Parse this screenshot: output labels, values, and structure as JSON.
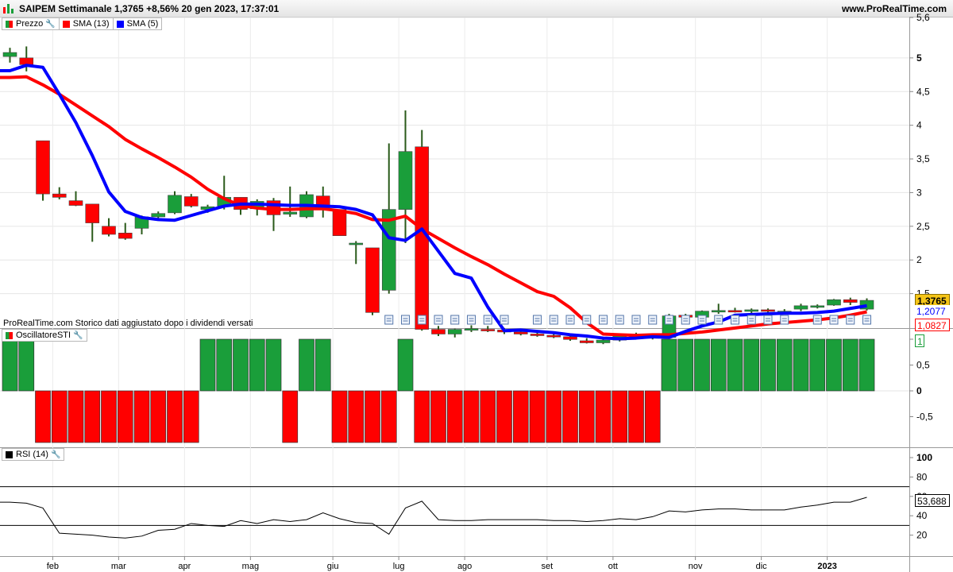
{
  "header": {
    "title": "SAIPEM Settimanale 1,3765 +8,56% 20 gen 2023, 17:37:01",
    "site": "www.ProRealTime.com"
  },
  "legend_price": [
    {
      "label": "Prezzo",
      "color": "#1a9e3a"
    },
    {
      "label": "SMA (13)",
      "color": "#ff0000"
    },
    {
      "label": "SMA (5)",
      "color": "#0000ff"
    }
  ],
  "legend_osc": {
    "label": "OscillatoreSTI",
    "color": "#1a9e3a"
  },
  "legend_rsi": {
    "label": "RSI (14)",
    "color": "#000000"
  },
  "note": "ProRealTime.com Storico dati aggiustato dopo i dividendi versati",
  "tags": {
    "price": "1,3765",
    "sma5": "1,2077",
    "sma13": "1,0827",
    "osc": "1",
    "rsi": "53,688"
  },
  "colors": {
    "up": "#1a9e3a",
    "down": "#ff0000",
    "sma13": "#ff0000",
    "sma5": "#0000ff",
    "wick": "#2a5a1a"
  },
  "chart_data": [
    {
      "type": "candlestick",
      "ylim": [
        1.0,
        5.6
      ],
      "y_ticks": [
        "5,6",
        "5",
        "4,5",
        "4",
        "3,5",
        "3",
        "2,5",
        "2",
        "1,5"
      ],
      "x_tick_labels": [
        "feb",
        "mar",
        "apr",
        "mag",
        "giu",
        "lug",
        "ago",
        "set",
        "ott",
        "nov",
        "dic",
        "2023"
      ],
      "x_tick_bar_index": [
        3,
        7,
        11,
        15,
        20,
        24,
        28,
        33,
        37,
        42,
        46,
        50
      ],
      "candles": [
        {
          "o": 5.02,
          "h": 5.15,
          "l": 4.93,
          "c": 5.08
        },
        {
          "o": 5.0,
          "h": 5.17,
          "l": 4.8,
          "c": 4.9
        },
        {
          "o": 3.77,
          "h": 3.77,
          "l": 2.88,
          "c": 2.98
        },
        {
          "o": 2.98,
          "h": 3.08,
          "l": 2.9,
          "c": 2.93
        },
        {
          "o": 2.88,
          "h": 3.02,
          "l": 2.8,
          "c": 2.81
        },
        {
          "o": 2.83,
          "h": 2.83,
          "l": 2.27,
          "c": 2.55
        },
        {
          "o": 2.5,
          "h": 2.62,
          "l": 2.35,
          "c": 2.38
        },
        {
          "o": 2.4,
          "h": 2.55,
          "l": 2.3,
          "c": 2.32
        },
        {
          "o": 2.47,
          "h": 2.66,
          "l": 2.38,
          "c": 2.64
        },
        {
          "o": 2.64,
          "h": 2.72,
          "l": 2.6,
          "c": 2.69
        },
        {
          "o": 2.7,
          "h": 3.02,
          "l": 2.68,
          "c": 2.96
        },
        {
          "o": 2.94,
          "h": 2.98,
          "l": 2.78,
          "c": 2.8
        },
        {
          "o": 2.75,
          "h": 2.82,
          "l": 2.7,
          "c": 2.79
        },
        {
          "o": 2.8,
          "h": 3.25,
          "l": 2.75,
          "c": 2.93
        },
        {
          "o": 2.93,
          "h": 2.93,
          "l": 2.67,
          "c": 2.75
        },
        {
          "o": 2.76,
          "h": 2.9,
          "l": 2.66,
          "c": 2.87
        },
        {
          "o": 2.88,
          "h": 2.92,
          "l": 2.43,
          "c": 2.67
        },
        {
          "o": 2.68,
          "h": 3.09,
          "l": 2.64,
          "c": 2.71
        },
        {
          "o": 2.64,
          "h": 3.02,
          "l": 2.62,
          "c": 2.97
        },
        {
          "o": 2.95,
          "h": 3.09,
          "l": 2.63,
          "c": 2.76
        },
        {
          "o": 2.75,
          "h": 2.75,
          "l": 2.36,
          "c": 2.36
        },
        {
          "o": 2.25,
          "h": 2.28,
          "l": 1.94,
          "c": 2.25
        },
        {
          "o": 2.18,
          "h": 2.18,
          "l": 1.18,
          "c": 1.22
        },
        {
          "o": 1.55,
          "h": 3.73,
          "l": 1.5,
          "c": 2.75
        },
        {
          "o": 2.75,
          "h": 4.22,
          "l": 2.25,
          "c": 3.61
        },
        {
          "o": 3.68,
          "h": 3.93,
          "l": 0.95,
          "c": 0.97
        },
        {
          "o": 0.97,
          "h": 1.02,
          "l": 0.87,
          "c": 0.9
        },
        {
          "o": 0.9,
          "h": 0.98,
          "l": 0.85,
          "c": 0.97
        },
        {
          "o": 0.96,
          "h": 1.03,
          "l": 0.93,
          "c": 0.98
        },
        {
          "o": 0.97,
          "h": 1.02,
          "l": 0.93,
          "c": 0.96
        },
        {
          "o": 0.96,
          "h": 0.99,
          "l": 0.9,
          "c": 0.93
        },
        {
          "o": 0.93,
          "h": 0.96,
          "l": 0.88,
          "c": 0.9
        },
        {
          "o": 0.9,
          "h": 0.95,
          "l": 0.86,
          "c": 0.88
        },
        {
          "o": 0.88,
          "h": 0.93,
          "l": 0.84,
          "c": 0.86
        },
        {
          "o": 0.86,
          "h": 0.9,
          "l": 0.8,
          "c": 0.82
        },
        {
          "o": 0.8,
          "h": 0.84,
          "l": 0.76,
          "c": 0.77
        },
        {
          "o": 0.77,
          "h": 0.83,
          "l": 0.75,
          "c": 0.81
        },
        {
          "o": 0.81,
          "h": 0.9,
          "l": 0.79,
          "c": 0.88
        },
        {
          "o": 0.88,
          "h": 0.92,
          "l": 0.82,
          "c": 0.86
        },
        {
          "o": 0.86,
          "h": 0.89,
          "l": 0.82,
          "c": 0.85
        },
        {
          "o": 0.85,
          "h": 1.2,
          "l": 0.83,
          "c": 1.17
        },
        {
          "o": 1.18,
          "h": 1.2,
          "l": 1.13,
          "c": 1.15
        },
        {
          "o": 1.15,
          "h": 1.25,
          "l": 1.12,
          "c": 1.24
        },
        {
          "o": 1.24,
          "h": 1.35,
          "l": 1.2,
          "c": 1.25
        },
        {
          "o": 1.25,
          "h": 1.29,
          "l": 1.22,
          "c": 1.24
        },
        {
          "o": 1.25,
          "h": 1.28,
          "l": 1.2,
          "c": 1.26
        },
        {
          "o": 1.26,
          "h": 1.28,
          "l": 1.21,
          "c": 1.25
        },
        {
          "o": 1.23,
          "h": 1.27,
          "l": 1.21,
          "c": 1.24
        },
        {
          "o": 1.27,
          "h": 1.35,
          "l": 1.24,
          "c": 1.32
        },
        {
          "o": 1.3,
          "h": 1.34,
          "l": 1.28,
          "c": 1.32
        },
        {
          "o": 1.33,
          "h": 1.42,
          "l": 1.32,
          "c": 1.41
        },
        {
          "o": 1.41,
          "h": 1.44,
          "l": 1.33,
          "c": 1.37
        },
        {
          "o": 1.27,
          "h": 1.43,
          "l": 1.25,
          "c": 1.4
        }
      ],
      "series": [
        {
          "name": "SMA (13)",
          "values": [
            4.71,
            4.72,
            4.6,
            4.46,
            4.3,
            4.14,
            3.98,
            3.79,
            3.65,
            3.52,
            3.38,
            3.23,
            3.05,
            2.91,
            2.81,
            2.77,
            2.75,
            2.75,
            2.76,
            2.76,
            2.73,
            2.69,
            2.6,
            2.59,
            2.65,
            2.46,
            2.32,
            2.18,
            2.05,
            1.93,
            1.79,
            1.66,
            1.53,
            1.46,
            1.29,
            1.07,
            0.9,
            0.89,
            0.88,
            0.89,
            0.89,
            0.91,
            0.93,
            0.96,
            0.99,
            1.02,
            1.05,
            1.07,
            1.09,
            1.11,
            1.14,
            1.18,
            1.23
          ]
        },
        {
          "name": "SMA (5)",
          "values": [
            4.81,
            4.89,
            4.86,
            4.46,
            4.04,
            3.55,
            3.01,
            2.72,
            2.63,
            2.6,
            2.59,
            2.66,
            2.73,
            2.8,
            2.83,
            2.83,
            2.82,
            2.81,
            2.81,
            2.8,
            2.79,
            2.75,
            2.67,
            2.33,
            2.29,
            2.46,
            2.13,
            1.8,
            1.73,
            1.3,
            0.95,
            0.96,
            0.94,
            0.92,
            0.89,
            0.87,
            0.84,
            0.83,
            0.84,
            0.86,
            0.85,
            0.94,
            1.02,
            1.08,
            1.18,
            1.19,
            1.2,
            1.21,
            1.21,
            1.22,
            1.24,
            1.28,
            1.32
          ]
        }
      ]
    },
    {
      "type": "bar",
      "name": "OscillatoreSTI",
      "ylim": [
        -1.0,
        1.0
      ],
      "y_ticks": [
        "1",
        "0,5",
        "0",
        "-0,5"
      ],
      "values": [
        1,
        1,
        -1,
        -1,
        -1,
        -1,
        -1,
        -1,
        -1,
        -1,
        -1,
        -1,
        1,
        1,
        1,
        1,
        1,
        -1,
        1,
        1,
        -1,
        -1,
        -1,
        -1,
        1,
        -1,
        -1,
        -1,
        -1,
        -1,
        -1,
        -1,
        -1,
        -1,
        -1,
        -1,
        -1,
        -1,
        -1,
        -1,
        1,
        1,
        1,
        1,
        1,
        1,
        1,
        1,
        1,
        1,
        1,
        1,
        1
      ]
    },
    {
      "type": "line",
      "name": "RSI (14)",
      "ylim": [
        0,
        100
      ],
      "y_ticks": [
        "100",
        "80",
        "60",
        "40",
        "20"
      ],
      "levels": [
        70,
        30
      ],
      "values": [
        54,
        53,
        48,
        22,
        21,
        20,
        18,
        17,
        19,
        25,
        26,
        32,
        30,
        29,
        35,
        32,
        36,
        34,
        36,
        43,
        37,
        33,
        32,
        21,
        48,
        55,
        36,
        35,
        35,
        36,
        36,
        36,
        36,
        35,
        35,
        34,
        35,
        37,
        36,
        39,
        45,
        44,
        46,
        47,
        47,
        46,
        46,
        46,
        49,
        51,
        54,
        54,
        59
      ]
    }
  ]
}
